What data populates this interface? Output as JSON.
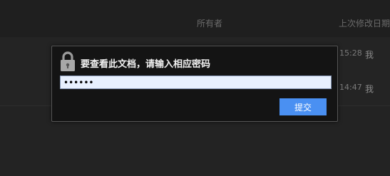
{
  "file_list": {
    "columns": {
      "owner": "所有者",
      "modified": "上次修改日期"
    },
    "rows": [
      {
        "modified": "15:28",
        "owner": "我"
      },
      {
        "modified": "14:47",
        "owner": "我"
      }
    ]
  },
  "password_dialog": {
    "icon": "lock-icon",
    "title": "要查看此文档，请输入相应密码",
    "password_value": "••••••",
    "submit_label": "提交"
  },
  "colors": {
    "background": "#232323",
    "dialog_background": "#141414",
    "submit_button": "#4a90f2",
    "input_background": "#e8f0fe"
  }
}
